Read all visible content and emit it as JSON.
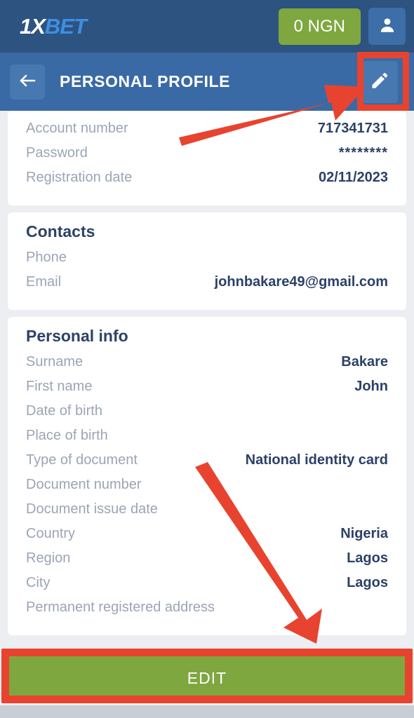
{
  "topbar": {
    "logo_part1": "1X",
    "logo_part2": "BET",
    "balance_label": "0 NGN",
    "profile_icon": "user-icon",
    "accent_green": "#7fa73f",
    "bar_color": "#2d5380"
  },
  "header": {
    "back_icon": "arrow-left-icon",
    "title": "PERSONAL PROFILE",
    "edit_icon": "pencil-icon",
    "bar_color": "#3a6aa5"
  },
  "cards": [
    {
      "title": "",
      "rows": [
        {
          "label": "Account number",
          "value": "717341731"
        },
        {
          "label": "Password",
          "value": "********"
        },
        {
          "label": "Registration date",
          "value": "02/11/2023"
        }
      ]
    },
    {
      "title": "Contacts",
      "rows": [
        {
          "label": "Phone",
          "value": ""
        },
        {
          "label": "Email",
          "value": "johnbakare49@gmail.com"
        }
      ]
    },
    {
      "title": "Personal info",
      "rows": [
        {
          "label": "Surname",
          "value": "Bakare"
        },
        {
          "label": "First name",
          "value": "John"
        },
        {
          "label": "Date of birth",
          "value": ""
        },
        {
          "label": "Place of birth",
          "value": ""
        },
        {
          "label": "Type of document",
          "value": "National identity card"
        },
        {
          "label": "Document number",
          "value": ""
        },
        {
          "label": "Document issue date",
          "value": ""
        },
        {
          "label": "Country",
          "value": "Nigeria"
        },
        {
          "label": "Region",
          "value": "Lagos"
        },
        {
          "label": "City",
          "value": "Lagos"
        },
        {
          "label": "Permanent registered address",
          "value": ""
        }
      ]
    }
  ],
  "footer": {
    "edit_label": "EDIT"
  },
  "annotations": {
    "highlight_color": "#e8432f",
    "arrow_to_edit_icon": "arrow pointing up-right at the pencil edit icon",
    "arrow_to_edit_button": "arrow pointing down-right at the EDIT button",
    "box_edit_icon": "red rectangle around pencil edit icon",
    "box_edit_button": "red rectangle around EDIT button"
  }
}
